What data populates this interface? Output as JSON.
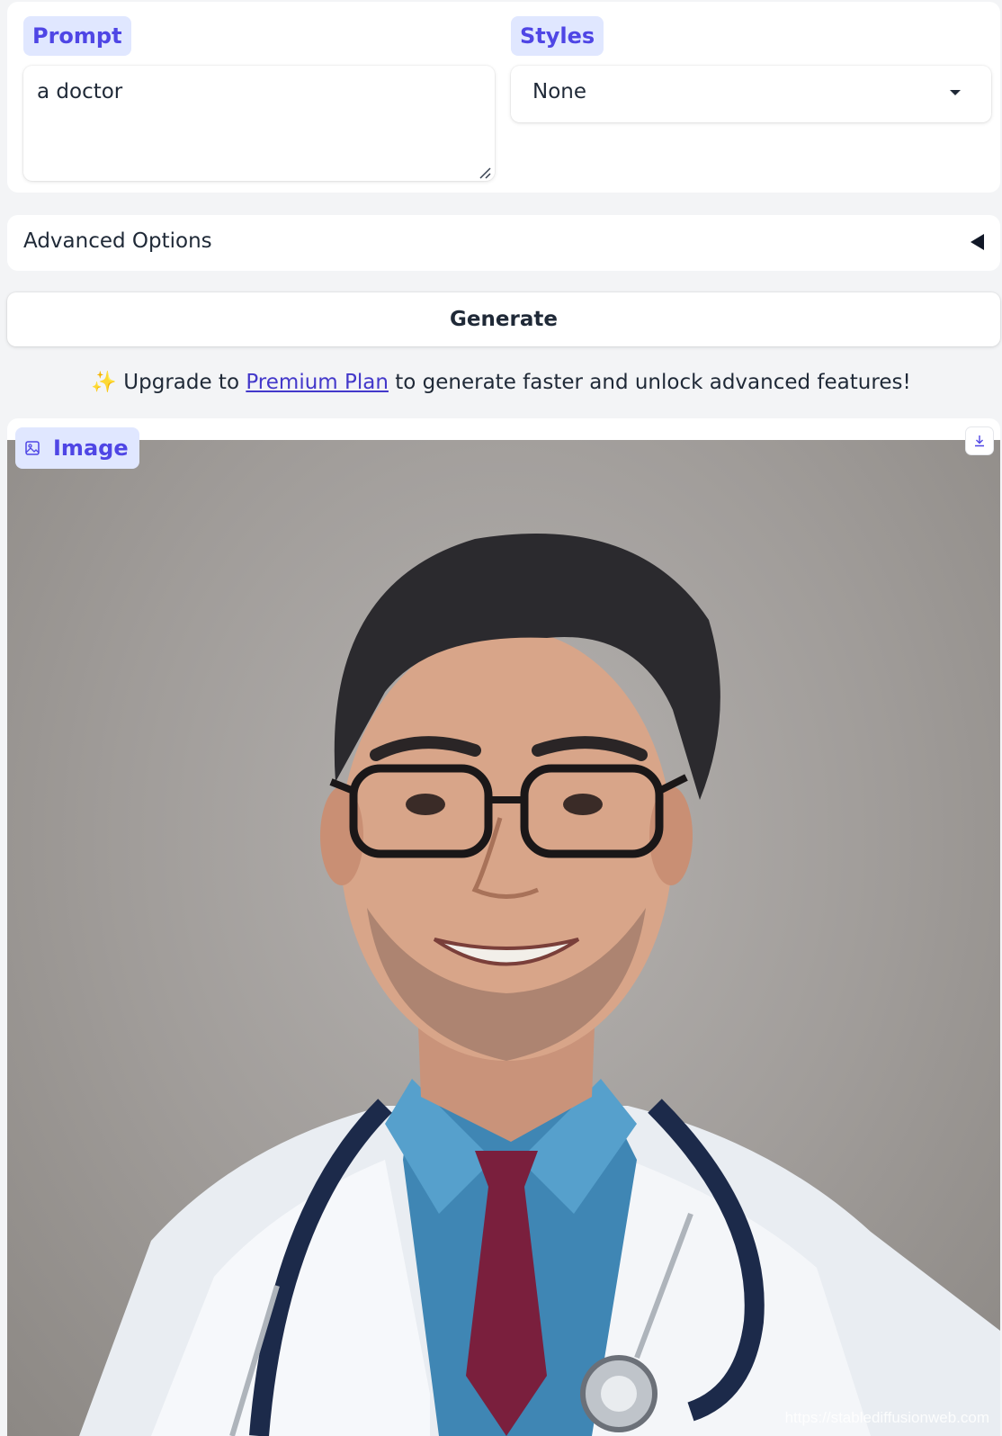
{
  "prompt": {
    "label": "Prompt",
    "value": "a doctor"
  },
  "styles": {
    "label": "Styles",
    "selected": "None"
  },
  "advanced": {
    "label": "Advanced Options"
  },
  "generate": {
    "label": "Generate"
  },
  "upgrade": {
    "sparkle": "✨",
    "prefix": "Upgrade to",
    "link": "Premium Plan",
    "suffix": "to generate faster and unlock advanced features!"
  },
  "output": {
    "label": "Image",
    "watermark": "https://stablediffusionweb.com"
  },
  "colors": {
    "accent": "#4f46e5",
    "chip_bg": "#e0e7ff",
    "link": "#4338ca"
  },
  "icons": {
    "image": "image-icon",
    "download": "download-icon",
    "caret": "caret-down-icon",
    "collapse": "triangle-left-icon"
  }
}
